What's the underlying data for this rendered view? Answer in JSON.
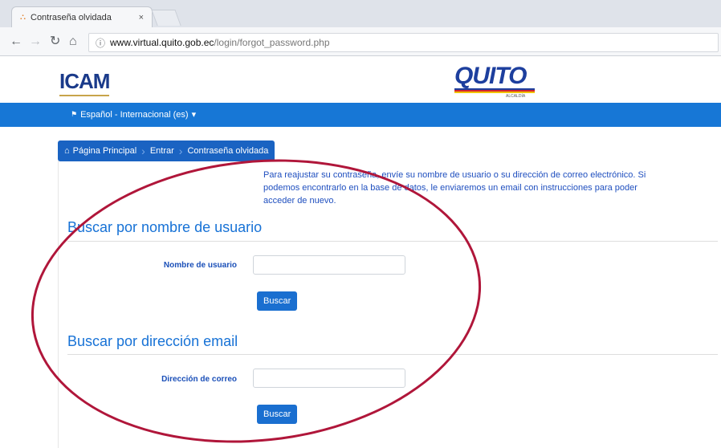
{
  "browser": {
    "tab_title": "Contraseña olvidada",
    "tab_close": "×",
    "url_host": "www.virtual.quito.gob.ec",
    "url_path": "/login/forgot_password.php"
  },
  "header": {
    "logo_left": "ICAM",
    "logo_right": "QUITO",
    "logo_right_sub": "ALCALDÍA"
  },
  "langbar": {
    "language": "Español - Internacional (es)",
    "caret": "▾"
  },
  "breadcrumb": {
    "items": [
      "Página Principal",
      "Entrar",
      "Contraseña olvidada"
    ]
  },
  "intro_text": "Para reajustar su contraseña, envíe su nombre de usuario o su dirección de correo electrónico. Si podemos encontrarlo en la base de datos, le enviaremos un email con instrucciones para poder acceder de nuevo.",
  "section_username": {
    "title": "Buscar por nombre de usuario",
    "label": "Nombre de usuario",
    "input_value": "",
    "button": "Buscar"
  },
  "section_email": {
    "title": "Buscar por dirección email",
    "label": "Dirección de correo",
    "input_value": "",
    "button": "Buscar"
  },
  "colors": {
    "brand_blue": "#1777d6",
    "breadcrumb_blue": "#1a63c2",
    "annotation_red": "#b0163a"
  }
}
